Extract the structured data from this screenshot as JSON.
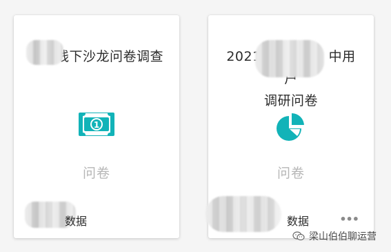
{
  "cards": [
    {
      "title_visible": "线下沙龙问卷调查",
      "type_label": "问卷",
      "data_label": "数据",
      "icon": "money-bill-icon"
    },
    {
      "title_visible": "2021 中用户调研问卷",
      "title_line1": "2021",
      "title_line1b": "中用户",
      "title_line2": "调研问卷",
      "type_label": "问卷",
      "data_label": "数据",
      "more_label": "•••",
      "icon": "pie-chart-icon"
    }
  ],
  "watermark": {
    "text": "梁山伯伯聊运营",
    "icon": "wechat-icon"
  },
  "colors": {
    "accent": "#12b3b8",
    "muted_text": "#b6b6b6",
    "card_bg": "#ffffff",
    "page_bg": "#f5f5f5"
  }
}
